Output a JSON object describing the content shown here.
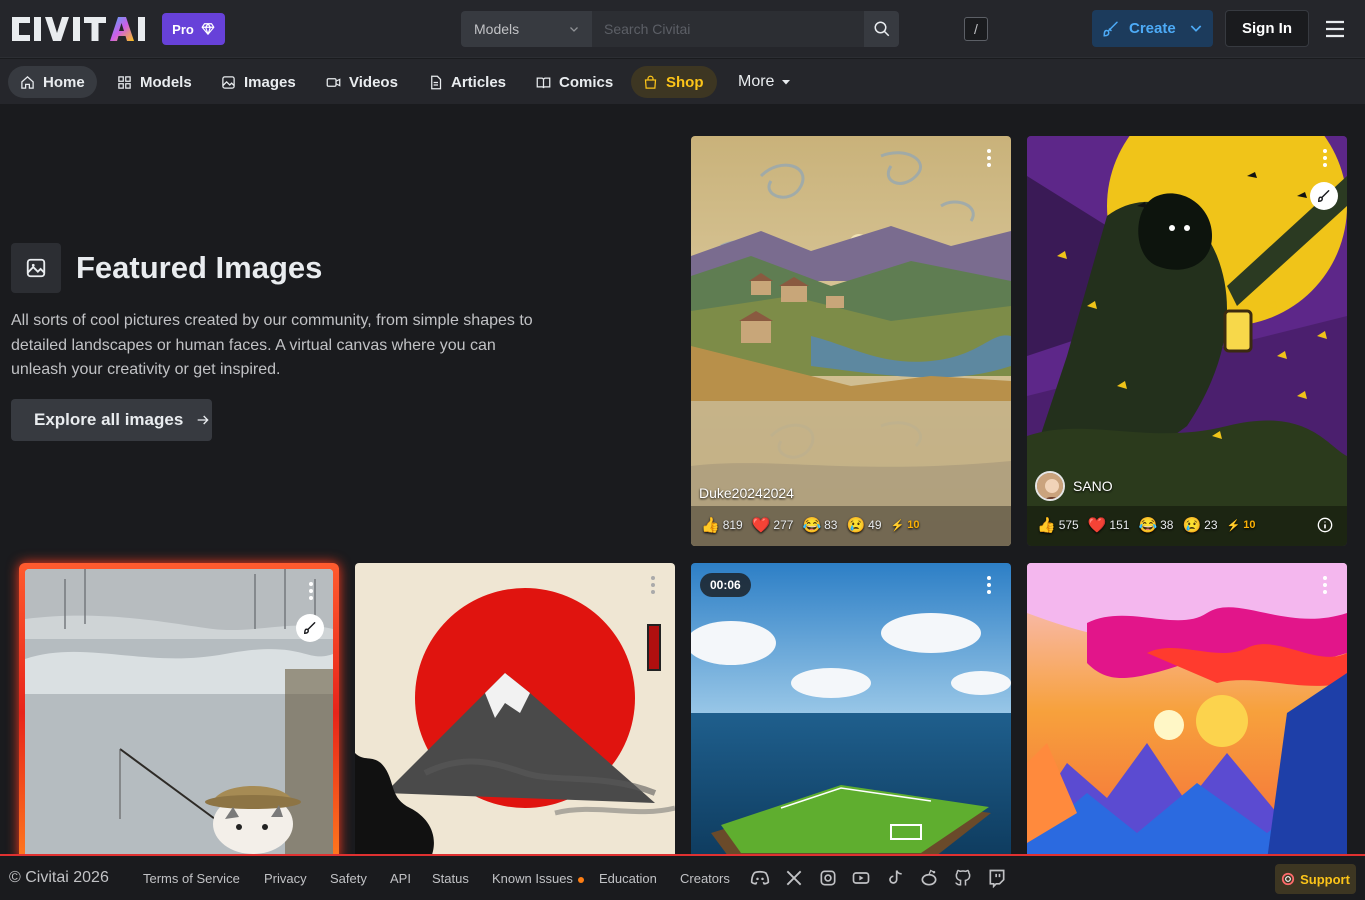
{
  "header": {
    "logo_text": "CIVITAI",
    "pro_label": "Pro",
    "search_type": "Models",
    "search_placeholder": "Search Civitai",
    "search_shortcut": "/",
    "create_label": "Create",
    "signin_label": "Sign In"
  },
  "nav": {
    "items": [
      {
        "label": "Home",
        "icon": "home-icon"
      },
      {
        "label": "Models",
        "icon": "grid-icon"
      },
      {
        "label": "Images",
        "icon": "photo-icon"
      },
      {
        "label": "Videos",
        "icon": "video-icon"
      },
      {
        "label": "Articles",
        "icon": "file-text-icon"
      },
      {
        "label": "Comics",
        "icon": "book-icon"
      },
      {
        "label": "Shop",
        "icon": "shopping-bag-icon"
      }
    ],
    "more_label": "More",
    "active": "Home",
    "shop_color": "#fcc419"
  },
  "featured": {
    "title": "Featured Images",
    "description": "All sorts of cool pictures created by our community, from simple shapes to detailed landscapes or human faces. A virtual canvas where you can unleash your creativity or get inspired.",
    "explore_label": "Explore all images"
  },
  "cards": [
    {
      "author": "Duke20242024",
      "reactions": {
        "like": "819",
        "heart": "277",
        "laugh": "83",
        "cry": "49",
        "buzz": "10"
      }
    },
    {
      "author": "SANO",
      "reactions": {
        "like": "575",
        "heart": "151",
        "laugh": "38",
        "cry": "23",
        "buzz": "10"
      }
    },
    {
      "author": ""
    },
    {
      "author": ""
    },
    {
      "duration": "00:06"
    },
    {
      "author": ""
    }
  ],
  "footer": {
    "copyright": "© Civitai 2026",
    "links": [
      "Terms of Service",
      "Privacy",
      "Safety",
      "API",
      "Status",
      "Known Issues",
      "Education",
      "Creators"
    ],
    "support_label": "Support",
    "accent_color": "#e03131"
  }
}
